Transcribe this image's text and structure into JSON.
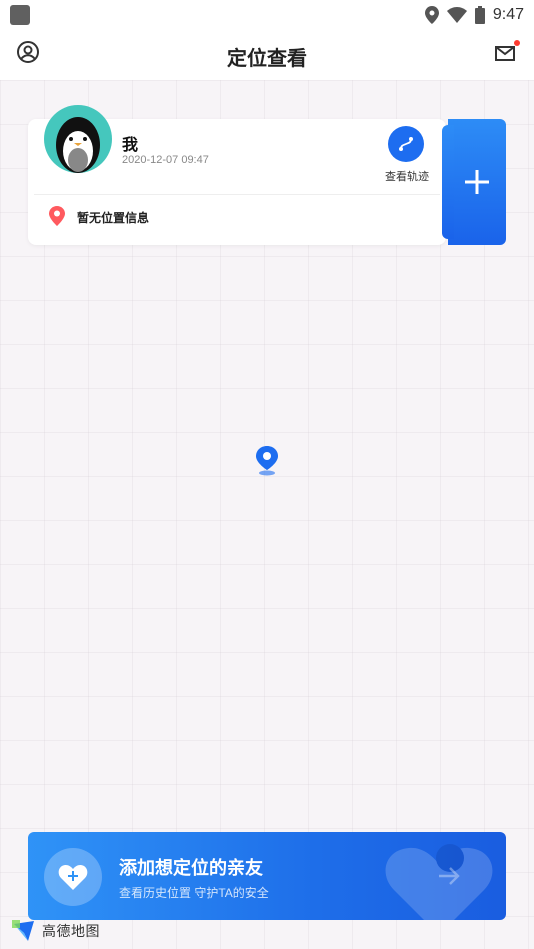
{
  "status_bar": {
    "time": "9:47"
  },
  "app_bar": {
    "title": "定位查看"
  },
  "location_card": {
    "name": "我",
    "timestamp": "2020-12-07 09:47",
    "track_label": "查看轨迹",
    "location_text": "暂无位置信息"
  },
  "add_button": {
    "label": "+"
  },
  "banner": {
    "title": "添加想定位的亲友",
    "subtitle": "查看历史位置 守护TA的安全"
  },
  "map_logo": {
    "text": "高德地图"
  },
  "colors": {
    "primary": "#1d6df0",
    "accent_pin": "#ff5a5f",
    "avatar_bg": "#45c7bd"
  }
}
